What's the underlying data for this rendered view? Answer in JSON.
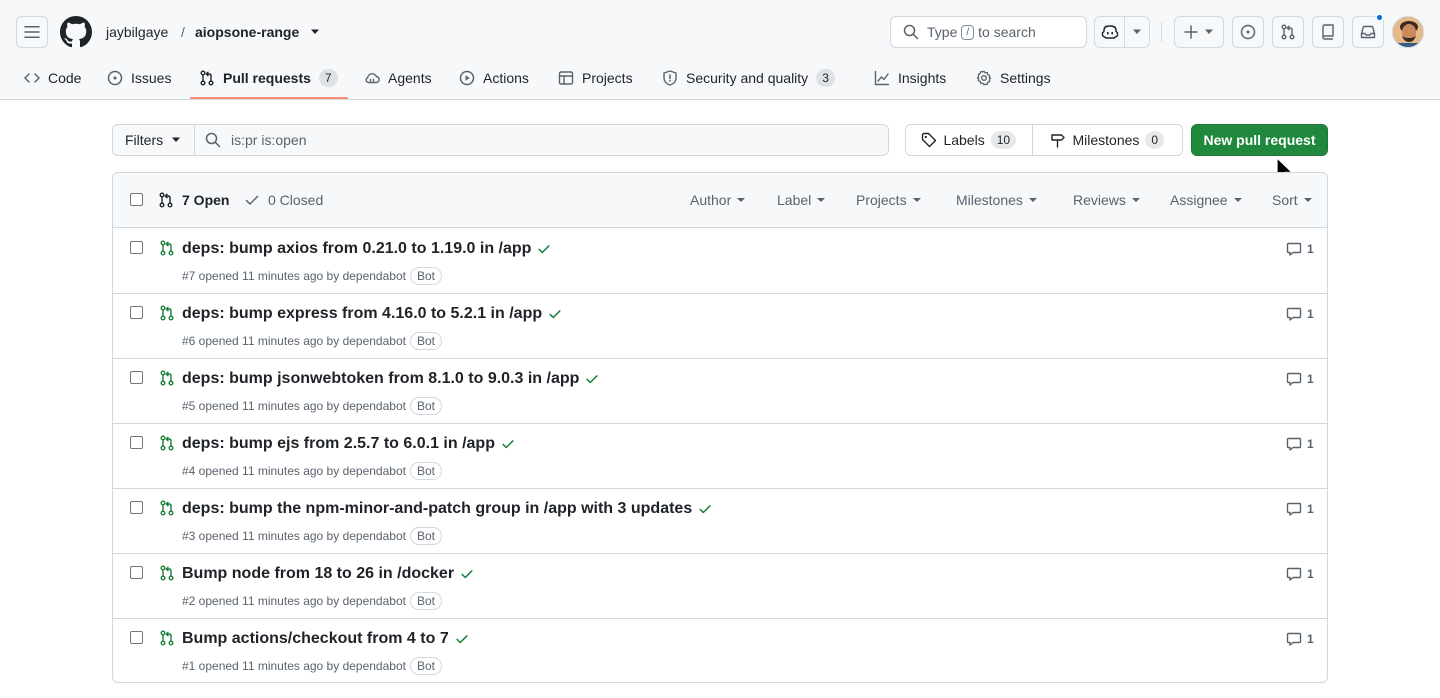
{
  "header": {
    "owner": "jaybilgaye",
    "separator": "/",
    "repo": "aiopsone-range",
    "search_prefix": "Type",
    "search_key": "/",
    "search_suffix": "to search"
  },
  "nav": {
    "tabs": [
      {
        "label": "Code",
        "icon": "code-icon"
      },
      {
        "label": "Issues",
        "icon": "issue-opened-icon"
      },
      {
        "label": "Pull requests",
        "icon": "git-pull-request-icon",
        "count": "7",
        "selected": true
      },
      {
        "label": "Agents",
        "icon": "agent-cloud-icon"
      },
      {
        "label": "Actions",
        "icon": "play-icon"
      },
      {
        "label": "Projects",
        "icon": "table-icon"
      },
      {
        "label": "Security and quality",
        "icon": "shield-icon",
        "count": "3"
      },
      {
        "label": "Insights",
        "icon": "graph-icon"
      },
      {
        "label": "Settings",
        "icon": "gear-icon"
      }
    ]
  },
  "toolbar": {
    "filters_label": "Filters",
    "filter_value": "is:pr is:open",
    "labels_label": "Labels",
    "labels_count": "10",
    "milestones_label": "Milestones",
    "milestones_count": "0",
    "new_pr_label": "New pull request"
  },
  "list": {
    "open_label": "7 Open",
    "closed_label": "0 Closed",
    "filters": [
      "Author",
      "Label",
      "Projects",
      "Milestones",
      "Reviews",
      "Assignee",
      "Sort"
    ],
    "rows": [
      {
        "title": "deps: bump axios from 0.21.0 to 1.19.0 in /app",
        "meta": "#7 opened 11 minutes ago by dependabot",
        "badge": "Bot",
        "comments": "1"
      },
      {
        "title": "deps: bump express from 4.16.0 to 5.2.1 in /app",
        "meta": "#6 opened 11 minutes ago by dependabot",
        "badge": "Bot",
        "comments": "1"
      },
      {
        "title": "deps: bump jsonwebtoken from 8.1.0 to 9.0.3 in /app",
        "meta": "#5 opened 11 minutes ago by dependabot",
        "badge": "Bot",
        "comments": "1"
      },
      {
        "title": "deps: bump ejs from 2.5.7 to 6.0.1 in /app",
        "meta": "#4 opened 11 minutes ago by dependabot",
        "badge": "Bot",
        "comments": "1"
      },
      {
        "title": "deps: bump the npm-minor-and-patch group in /app with 3 updates",
        "meta": "#3 opened 11 minutes ago by dependabot",
        "badge": "Bot",
        "comments": "1"
      },
      {
        "title": "Bump node from 18 to 26 in /docker",
        "meta": "#2 opened 11 minutes ago by dependabot",
        "badge": "Bot",
        "comments": "1"
      },
      {
        "title": "Bump actions/checkout from 4 to 7",
        "meta": "#1 opened 11 minutes ago by dependabot",
        "badge": "Bot",
        "comments": "1"
      }
    ]
  },
  "colors": {
    "open_green": "#1a7f37",
    "primary_button": "#1f883d",
    "tab_underline": "#fd8c73",
    "notification_dot": "#0969da"
  }
}
